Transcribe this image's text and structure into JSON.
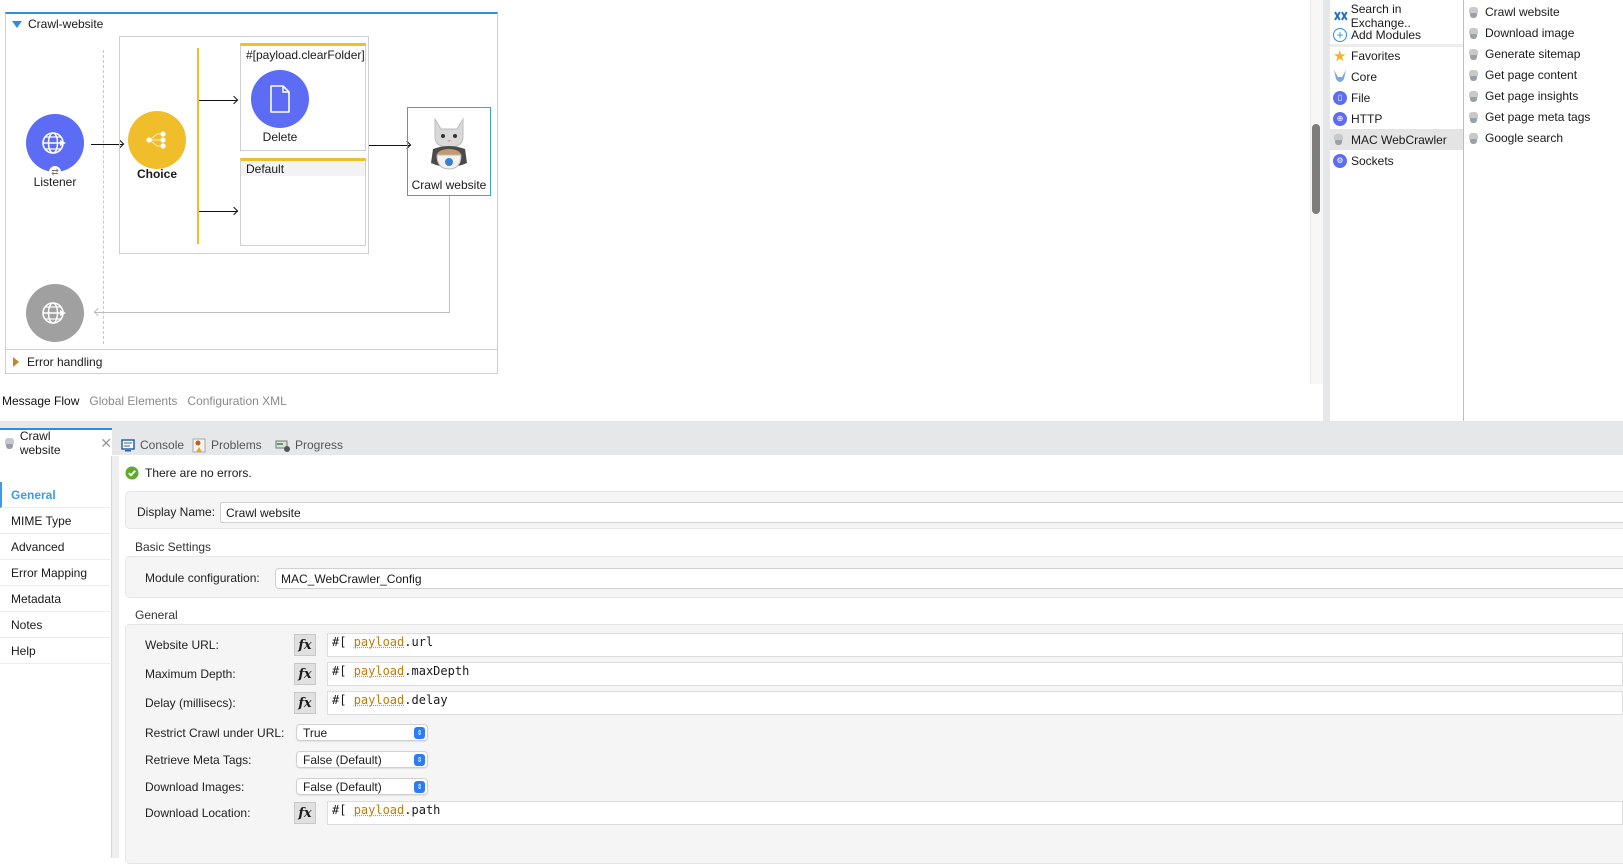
{
  "flow": {
    "name": "Crawl-website",
    "listener_label": "Listener",
    "choice_label": "Choice",
    "route_expression": "#[payload.clearFolder]",
    "delete_label": "Delete",
    "default_label": "Default",
    "crawl_label": "Crawl website",
    "error_handling_label": "Error handling"
  },
  "view_tabs": [
    "Message Flow",
    "Global Elements",
    "Configuration XML"
  ],
  "palette": {
    "search_label": "Search in Exchange..",
    "add_modules_label": "Add Modules",
    "categories": [
      {
        "label": "Favorites",
        "icon": "star-icon"
      },
      {
        "label": "Core",
        "icon": "mule-icon"
      },
      {
        "label": "File",
        "icon": "file-icon"
      },
      {
        "label": "HTTP",
        "icon": "http-icon"
      },
      {
        "label": "MAC WebCrawler",
        "icon": "webcrawler-icon",
        "selected": true
      },
      {
        "label": "Sockets",
        "icon": "sockets-icon"
      }
    ],
    "operations": [
      "Crawl website",
      "Download image",
      "Generate sitemap",
      "Get page content",
      "Get page insights",
      "Get page meta tags",
      "Google search"
    ]
  },
  "editor_tab": {
    "label": "Crawl website"
  },
  "panel_tabs": [
    "Console",
    "Problems",
    "Progress"
  ],
  "nav": [
    "General",
    "MIME Type",
    "Advanced",
    "Error Mapping",
    "Metadata",
    "Notes",
    "Help"
  ],
  "status": "There are no errors.",
  "props": {
    "display_name_label": "Display Name:",
    "display_name_value": "Crawl website",
    "basic_settings_title": "Basic Settings",
    "module_config_label": "Module configuration:",
    "module_config_value": "MAC_WebCrawler_Config",
    "general_title": "General",
    "website_url_label": "Website URL:",
    "max_depth_label": "Maximum Depth:",
    "delay_label": "Delay (millisecs):",
    "restrict_label": "Restrict Crawl under URL:",
    "restrict_value": "True",
    "meta_tags_label": "Retrieve Meta Tags:",
    "meta_tags_value": "False (Default)",
    "download_images_label": "Download Images:",
    "download_images_value": "False (Default)",
    "download_location_label": "Download Location:",
    "expr_prefix": "#[",
    "payload_kw": "payload",
    "website_url_field": ".url",
    "max_depth_field": ".maxDepth",
    "delay_field": ".delay",
    "download_location_field": ".path"
  },
  "colors": {
    "accent": "#2d8ee0",
    "connector": "#5c6cf5",
    "choice": "#f0be2b",
    "source_gray": "#a0a0a0"
  }
}
